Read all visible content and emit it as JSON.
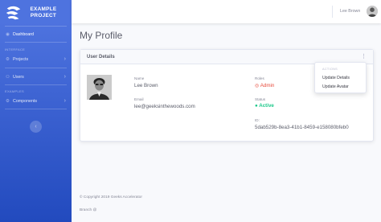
{
  "brand": {
    "line1": "EXAMPLE",
    "line2": "PROJECT",
    "icon": "paper-plane-logo"
  },
  "sidebar": {
    "dashboard": {
      "label": "Dashboard",
      "icon": "dashboard-icon"
    },
    "heading_interface": "INTERFACE",
    "projects": {
      "label": "Projects",
      "icon": "gear-icon"
    },
    "users": {
      "label": "Users",
      "icon": "users-icon"
    },
    "heading_examples": "EXAMPLES",
    "components": {
      "label": "Components",
      "icon": "gear-icon"
    },
    "toggle_icon": "‹"
  },
  "topbar": {
    "user_name": "Lee Brown"
  },
  "page": {
    "title": "My Profile"
  },
  "card": {
    "title": "User Details",
    "name_label": "Name",
    "name_value": "Lee Brown",
    "email_label": "Email",
    "email_value": "lee@geeksinthewoods.com",
    "roles_label": "Roles",
    "roles_value": "Admin",
    "status_label": "Status",
    "status_value": "Active",
    "id_label": "ID:",
    "id_value": "5dab529b-8ea3-41b1-8459-e158080bfeb0"
  },
  "dropdown": {
    "header": "ACTIONS",
    "items": [
      "Update Details",
      "Update Avatar"
    ]
  },
  "footer": {
    "copyright": "© Copyright 2019 Geeks Accelerator",
    "branch": "Branch @"
  },
  "colors": {
    "sidebar": "#4e73df",
    "role": "#e74a3b",
    "status": "#1cc88a"
  }
}
